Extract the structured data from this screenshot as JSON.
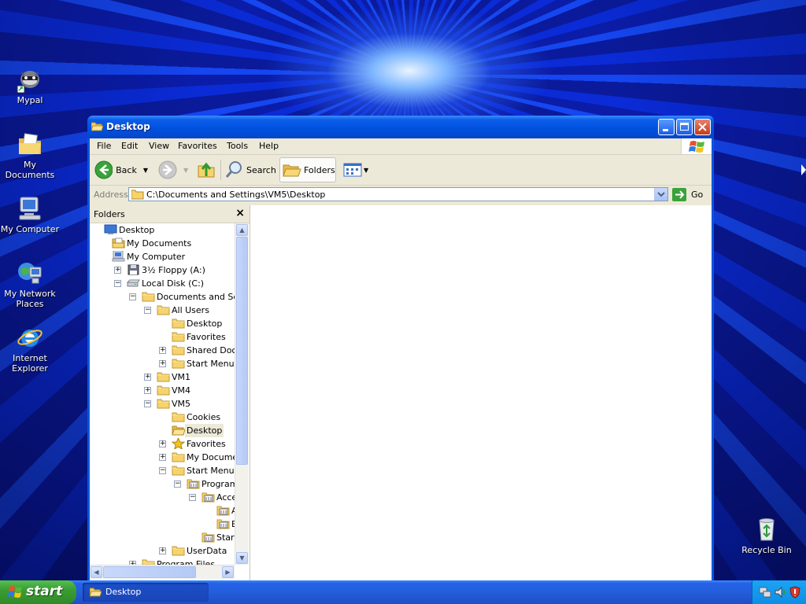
{
  "desktop": {
    "icons": [
      {
        "label": "Mypal",
        "icon": "mypal-raccoon-icon"
      },
      {
        "label": "My Documents",
        "icon": "my-documents-icon"
      },
      {
        "label": "My Computer",
        "icon": "my-computer-icon"
      },
      {
        "label": "My Network Places",
        "icon": "network-places-icon"
      },
      {
        "label": "Internet Explorer",
        "icon": "internet-explorer-icon"
      },
      {
        "label": "Recycle Bin",
        "icon": "recycle-bin-icon"
      }
    ]
  },
  "window": {
    "title": "Desktop",
    "menu": [
      "File",
      "Edit",
      "View",
      "Favorites",
      "Tools",
      "Help"
    ],
    "toolbar": {
      "back": "Back",
      "search": "Search",
      "folders": "Folders"
    },
    "address": {
      "label": "Address",
      "value": "C:\\Documents and Settings\\VM5\\Desktop",
      "go": "Go"
    },
    "folders_pane": {
      "title": "Folders",
      "tree": [
        {
          "label": "Desktop",
          "depth": 0,
          "expander": "",
          "icon": "desktop"
        },
        {
          "label": "My Documents",
          "depth": 1,
          "expander": "",
          "icon": "mydocs"
        },
        {
          "label": "My Computer",
          "depth": 1,
          "expander": "",
          "icon": "computer"
        },
        {
          "label": "3½ Floppy (A:)",
          "depth": 2,
          "expander": "+",
          "icon": "floppy"
        },
        {
          "label": "Local Disk (C:)",
          "depth": 2,
          "expander": "−",
          "icon": "disk"
        },
        {
          "label": "Documents and Settings",
          "depth": 3,
          "expander": "−",
          "icon": "folder"
        },
        {
          "label": "All Users",
          "depth": 4,
          "expander": "−",
          "icon": "folder"
        },
        {
          "label": "Desktop",
          "depth": 5,
          "expander": "",
          "icon": "folder"
        },
        {
          "label": "Favorites",
          "depth": 5,
          "expander": "",
          "icon": "folder"
        },
        {
          "label": "Shared Documents",
          "depth": 5,
          "expander": "+",
          "icon": "folder"
        },
        {
          "label": "Start Menu",
          "depth": 5,
          "expander": "+",
          "icon": "folder"
        },
        {
          "label": "VM1",
          "depth": 4,
          "expander": "+",
          "icon": "folder"
        },
        {
          "label": "VM4",
          "depth": 4,
          "expander": "+",
          "icon": "folder"
        },
        {
          "label": "VM5",
          "depth": 4,
          "expander": "−",
          "icon": "folder"
        },
        {
          "label": "Cookies",
          "depth": 5,
          "expander": "",
          "icon": "folder"
        },
        {
          "label": "Desktop",
          "depth": 5,
          "expander": "",
          "icon": "folder-open",
          "selected": true
        },
        {
          "label": "Favorites",
          "depth": 5,
          "expander": "+",
          "icon": "star"
        },
        {
          "label": "My Documents",
          "depth": 5,
          "expander": "+",
          "icon": "folder"
        },
        {
          "label": "Start Menu",
          "depth": 5,
          "expander": "−",
          "icon": "folder"
        },
        {
          "label": "Programs",
          "depth": 6,
          "expander": "−",
          "icon": "programs"
        },
        {
          "label": "Accessories",
          "depth": 7,
          "expander": "−",
          "icon": "programs"
        },
        {
          "label": "Accessibility",
          "depth": 8,
          "expander": "",
          "icon": "programs"
        },
        {
          "label": "Entertainment",
          "depth": 8,
          "expander": "",
          "icon": "programs"
        },
        {
          "label": "Startup",
          "depth": 7,
          "expander": "",
          "icon": "programs"
        },
        {
          "label": "UserData",
          "depth": 5,
          "expander": "+",
          "icon": "folder"
        },
        {
          "label": "Program Files",
          "depth": 3,
          "expander": "+",
          "icon": "folder"
        }
      ]
    }
  },
  "taskbar": {
    "start_label": "start",
    "task": "Desktop"
  },
  "colors": {
    "folder": "#f6d36b",
    "folder_dark": "#d9a935",
    "xp_blue": "#0050e0"
  }
}
